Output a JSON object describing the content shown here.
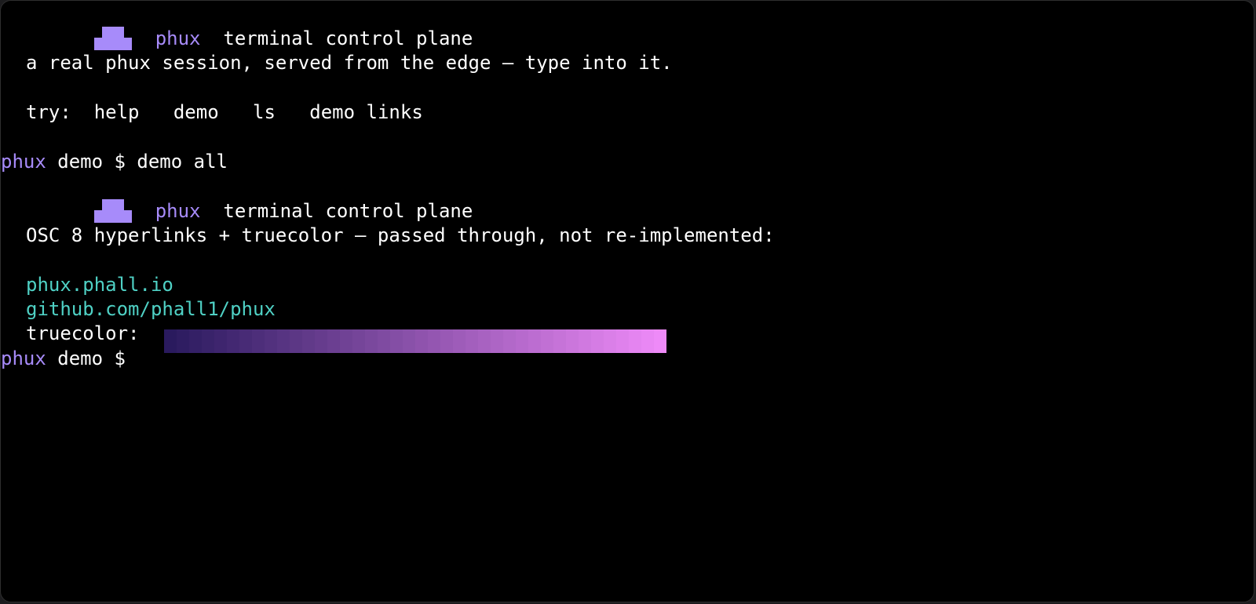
{
  "banner_1": {
    "brand": "phux",
    "tagline": "terminal control plane"
  },
  "intro": "a real phux session, served from the edge — type into it.",
  "try_line": {
    "label": "try:",
    "commands": [
      "help",
      "demo",
      "ls",
      "demo links"
    ]
  },
  "prompt_1": {
    "user": "phux",
    "rest": " demo $ ",
    "command": "demo all"
  },
  "banner_2": {
    "brand": "phux",
    "tagline": "terminal control plane"
  },
  "osc_line": "OSC 8 hyperlinks + truecolor — passed through, not re-implemented:",
  "links": [
    "phux.phall.io",
    "github.com/phall1/phux"
  ],
  "truecolor": {
    "label": "truecolor:",
    "from_color": "#2a1a5e",
    "to_color": "#ee8af8",
    "steps": 40
  },
  "prompt_2": {
    "user": "phux",
    "rest": " demo $ "
  },
  "colors": {
    "background": "#000000",
    "text": "#ffffff",
    "brand": "#a78bfa",
    "link": "#4fd1c5"
  },
  "icons": {
    "logo": "phux-logo-icon"
  }
}
